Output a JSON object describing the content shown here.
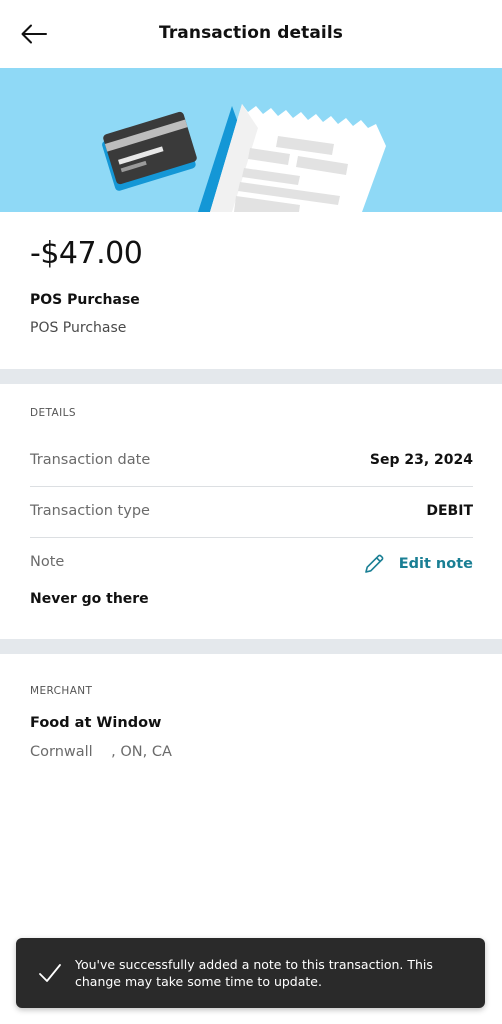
{
  "header": {
    "title": "Transaction details",
    "back_icon": "arrow-left-icon"
  },
  "hero": {
    "illustration": "credit-card-and-receipt",
    "background_color": "#8fd9f6"
  },
  "transaction": {
    "amount": "-$47.00",
    "description_title": "POS Purchase",
    "description_sub": "POS Purchase"
  },
  "details": {
    "section_label": "DETAILS",
    "rows": [
      {
        "label": "Transaction date",
        "value": "Sep 23, 2024"
      },
      {
        "label": "Transaction type",
        "value": "DEBIT"
      }
    ],
    "note_label": "Note",
    "edit_note_label": "Edit note",
    "edit_icon": "pencil-icon",
    "note_text": "Never go there"
  },
  "merchant": {
    "section_label": "MERCHANT",
    "name": "Food at Window",
    "location": "Cornwall    , ON, CA"
  },
  "snackbar": {
    "icon": "checkmark-icon",
    "message": "You've successfully added a note to this transaction. This change may take some time to update."
  },
  "colors": {
    "accent": "#1a7f94",
    "divider_band": "#e4e8ec",
    "snackbar_bg": "#2a2a2a"
  }
}
